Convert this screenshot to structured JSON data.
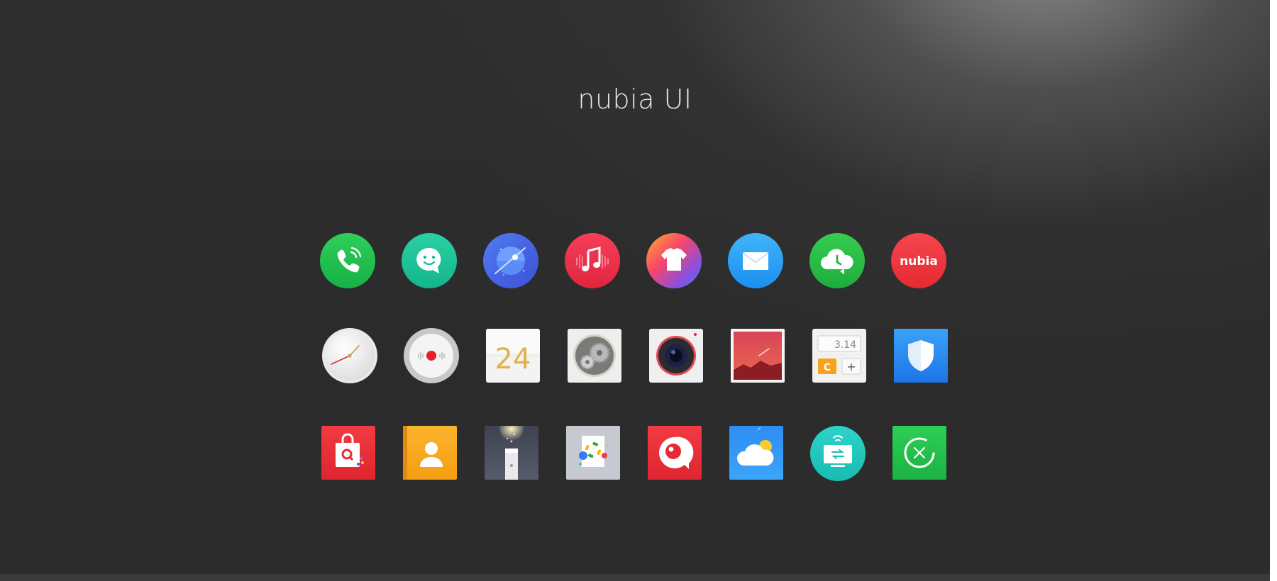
{
  "title": "nubia UI",
  "icons": [
    {
      "name": "phone-icon"
    },
    {
      "name": "messages-icon"
    },
    {
      "name": "browser-icon"
    },
    {
      "name": "music-icon"
    },
    {
      "name": "theme-icon"
    },
    {
      "name": "mail-icon"
    },
    {
      "name": "cloud-backup-icon"
    },
    {
      "name": "nubia-community-icon",
      "logo_text": "nubia"
    },
    {
      "name": "clock-icon"
    },
    {
      "name": "recorder-icon"
    },
    {
      "name": "calendar-icon",
      "day": "24"
    },
    {
      "name": "settings-icon"
    },
    {
      "name": "camera-icon"
    },
    {
      "name": "gallery-icon"
    },
    {
      "name": "calculator-icon",
      "display": "3.14",
      "key_clear": "C",
      "key_plus": "+"
    },
    {
      "name": "security-icon"
    },
    {
      "name": "app-store-icon"
    },
    {
      "name": "contacts-icon"
    },
    {
      "name": "flashlight-icon"
    },
    {
      "name": "notes-icon"
    },
    {
      "name": "video-icon"
    },
    {
      "name": "weather-icon"
    },
    {
      "name": "file-transfer-icon"
    },
    {
      "name": "cleaner-icon"
    }
  ]
}
